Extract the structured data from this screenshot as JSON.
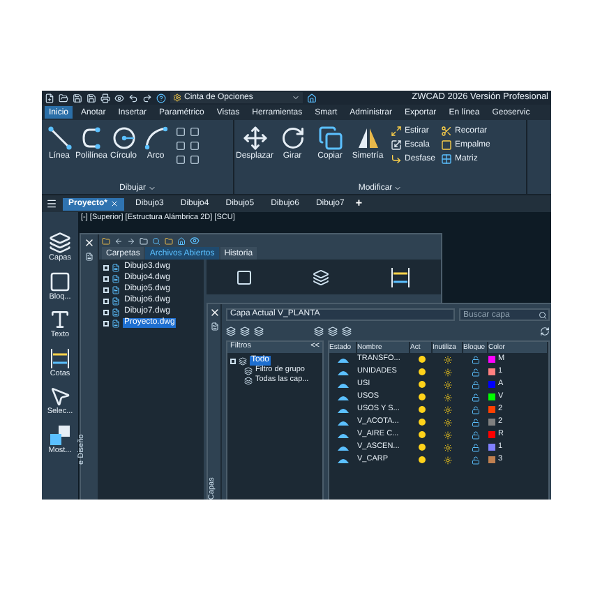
{
  "title_bar": {
    "workspace": "Cinta de Opciones",
    "title": "ZWCAD 2026 Versión Profesional"
  },
  "menu_tabs": [
    {
      "label": "Inicio",
      "selected": true
    },
    {
      "label": "Anotar",
      "selected": false
    },
    {
      "label": "Insertar",
      "selected": false
    },
    {
      "label": "Paramétrico",
      "selected": false
    },
    {
      "label": "Vistas",
      "selected": false
    },
    {
      "label": "Herramientas",
      "selected": false
    },
    {
      "label": "Smart",
      "selected": false
    },
    {
      "label": "Administrar",
      "selected": false
    },
    {
      "label": "Exportar",
      "selected": false
    },
    {
      "label": "En línea",
      "selected": false
    },
    {
      "label": "Geoservic",
      "selected": false
    }
  ],
  "ribbon": {
    "draw_group": {
      "label": "Dibujar",
      "tools": [
        {
          "kind": "line",
          "label": "Línea"
        },
        {
          "kind": "polyline",
          "label": "Polilínea"
        },
        {
          "kind": "circle",
          "label": "Círculo"
        },
        {
          "kind": "arc",
          "label": "Arco"
        }
      ]
    },
    "modify_group": {
      "label": "Modificar",
      "tools": [
        {
          "kind": "move",
          "label": "Desplazar"
        },
        {
          "kind": "rotate",
          "label": "Girar"
        },
        {
          "kind": "copy",
          "label": "Copiar"
        },
        {
          "kind": "mirror",
          "label": "Simetría"
        }
      ],
      "small_tools": [
        {
          "kind": "stretch",
          "label": "Estirar"
        },
        {
          "kind": "scale",
          "label": "Escala"
        },
        {
          "kind": "offset",
          "label": "Desfase"
        },
        {
          "kind": "trim",
          "label": "Recortar"
        },
        {
          "kind": "fillet",
          "label": "Empalme"
        },
        {
          "kind": "array",
          "label": "Matriz"
        }
      ]
    }
  },
  "doc_tabs": [
    {
      "label": "Proyecto*",
      "selected": true
    },
    {
      "label": "Dibujo3",
      "selected": false
    },
    {
      "label": "Dibujo4",
      "selected": false
    },
    {
      "label": "Dibujo5",
      "selected": false
    },
    {
      "label": "Dibujo6",
      "selected": false
    },
    {
      "label": "Dibujo7",
      "selected": false
    }
  ],
  "new_tab": "+",
  "viewport_label": "[-] [Superior] [Estructura Alámbrica 2D] [SCU]",
  "side_tools": [
    {
      "kind": "layers",
      "label": "Capas"
    },
    {
      "kind": "block",
      "label": "Bloq..."
    },
    {
      "kind": "text",
      "label": "Texto"
    },
    {
      "kind": "dimension",
      "label": "Cotas"
    },
    {
      "kind": "select",
      "label": "Selec..."
    },
    {
      "kind": "show",
      "label": "Most..."
    }
  ],
  "design_center": {
    "side_title": "e Diseño",
    "tabs": [
      {
        "label": "Carpetas",
        "selected": false
      },
      {
        "label": "Archivos Abiertos",
        "selected": true
      },
      {
        "label": "Historia",
        "selected": false
      }
    ],
    "files": [
      {
        "label": "Dibujo3.dwg",
        "selected": false
      },
      {
        "label": "Dibujo4.dwg",
        "selected": false
      },
      {
        "label": "Dibujo5.dwg",
        "selected": false
      },
      {
        "label": "Dibujo6.dwg",
        "selected": false
      },
      {
        "label": "Dibujo7.dwg",
        "selected": false
      },
      {
        "label": "Proyecto.dwg",
        "selected": true
      }
    ]
  },
  "layer_panel": {
    "side_title": "Capas",
    "current_layer": "Capa Actual V_PLANTA",
    "search": {
      "placeholder": "Buscar capa"
    },
    "filters_title": "Filtros",
    "collapse": "<<",
    "filters": [
      {
        "label": "Todo",
        "selected": true,
        "children": [
          {
            "label": "Filtro de grupo",
            "selected": false
          },
          {
            "label": "Todas las cap...",
            "selected": false
          }
        ]
      }
    ],
    "columns": [
      "Estado",
      "Nombre",
      "Act",
      "Inutiliza",
      "Bloque",
      "Color"
    ],
    "rows": [
      {
        "name": "TRANSFO...",
        "color": "#ff00ff",
        "color_label": "M"
      },
      {
        "name": "UNIDADES",
        "color": "#ff8080",
        "color_label": "1"
      },
      {
        "name": "USI",
        "color": "#0000ff",
        "color_label": "A"
      },
      {
        "name": "USOS",
        "color": "#00ff00",
        "color_label": "V"
      },
      {
        "name": "USOS Y S...",
        "color": "#ff4000",
        "color_label": "2"
      },
      {
        "name": "V_ACOTA...",
        "color": "#808080",
        "color_label": "2"
      },
      {
        "name": "V_AIRE C...",
        "color": "#ff0000",
        "color_label": "R"
      },
      {
        "name": "V_ASCEN...",
        "color": "#8080ff",
        "color_label": "1"
      },
      {
        "name": "V_CARP",
        "color": "#c08050",
        "color_label": "3"
      }
    ]
  }
}
